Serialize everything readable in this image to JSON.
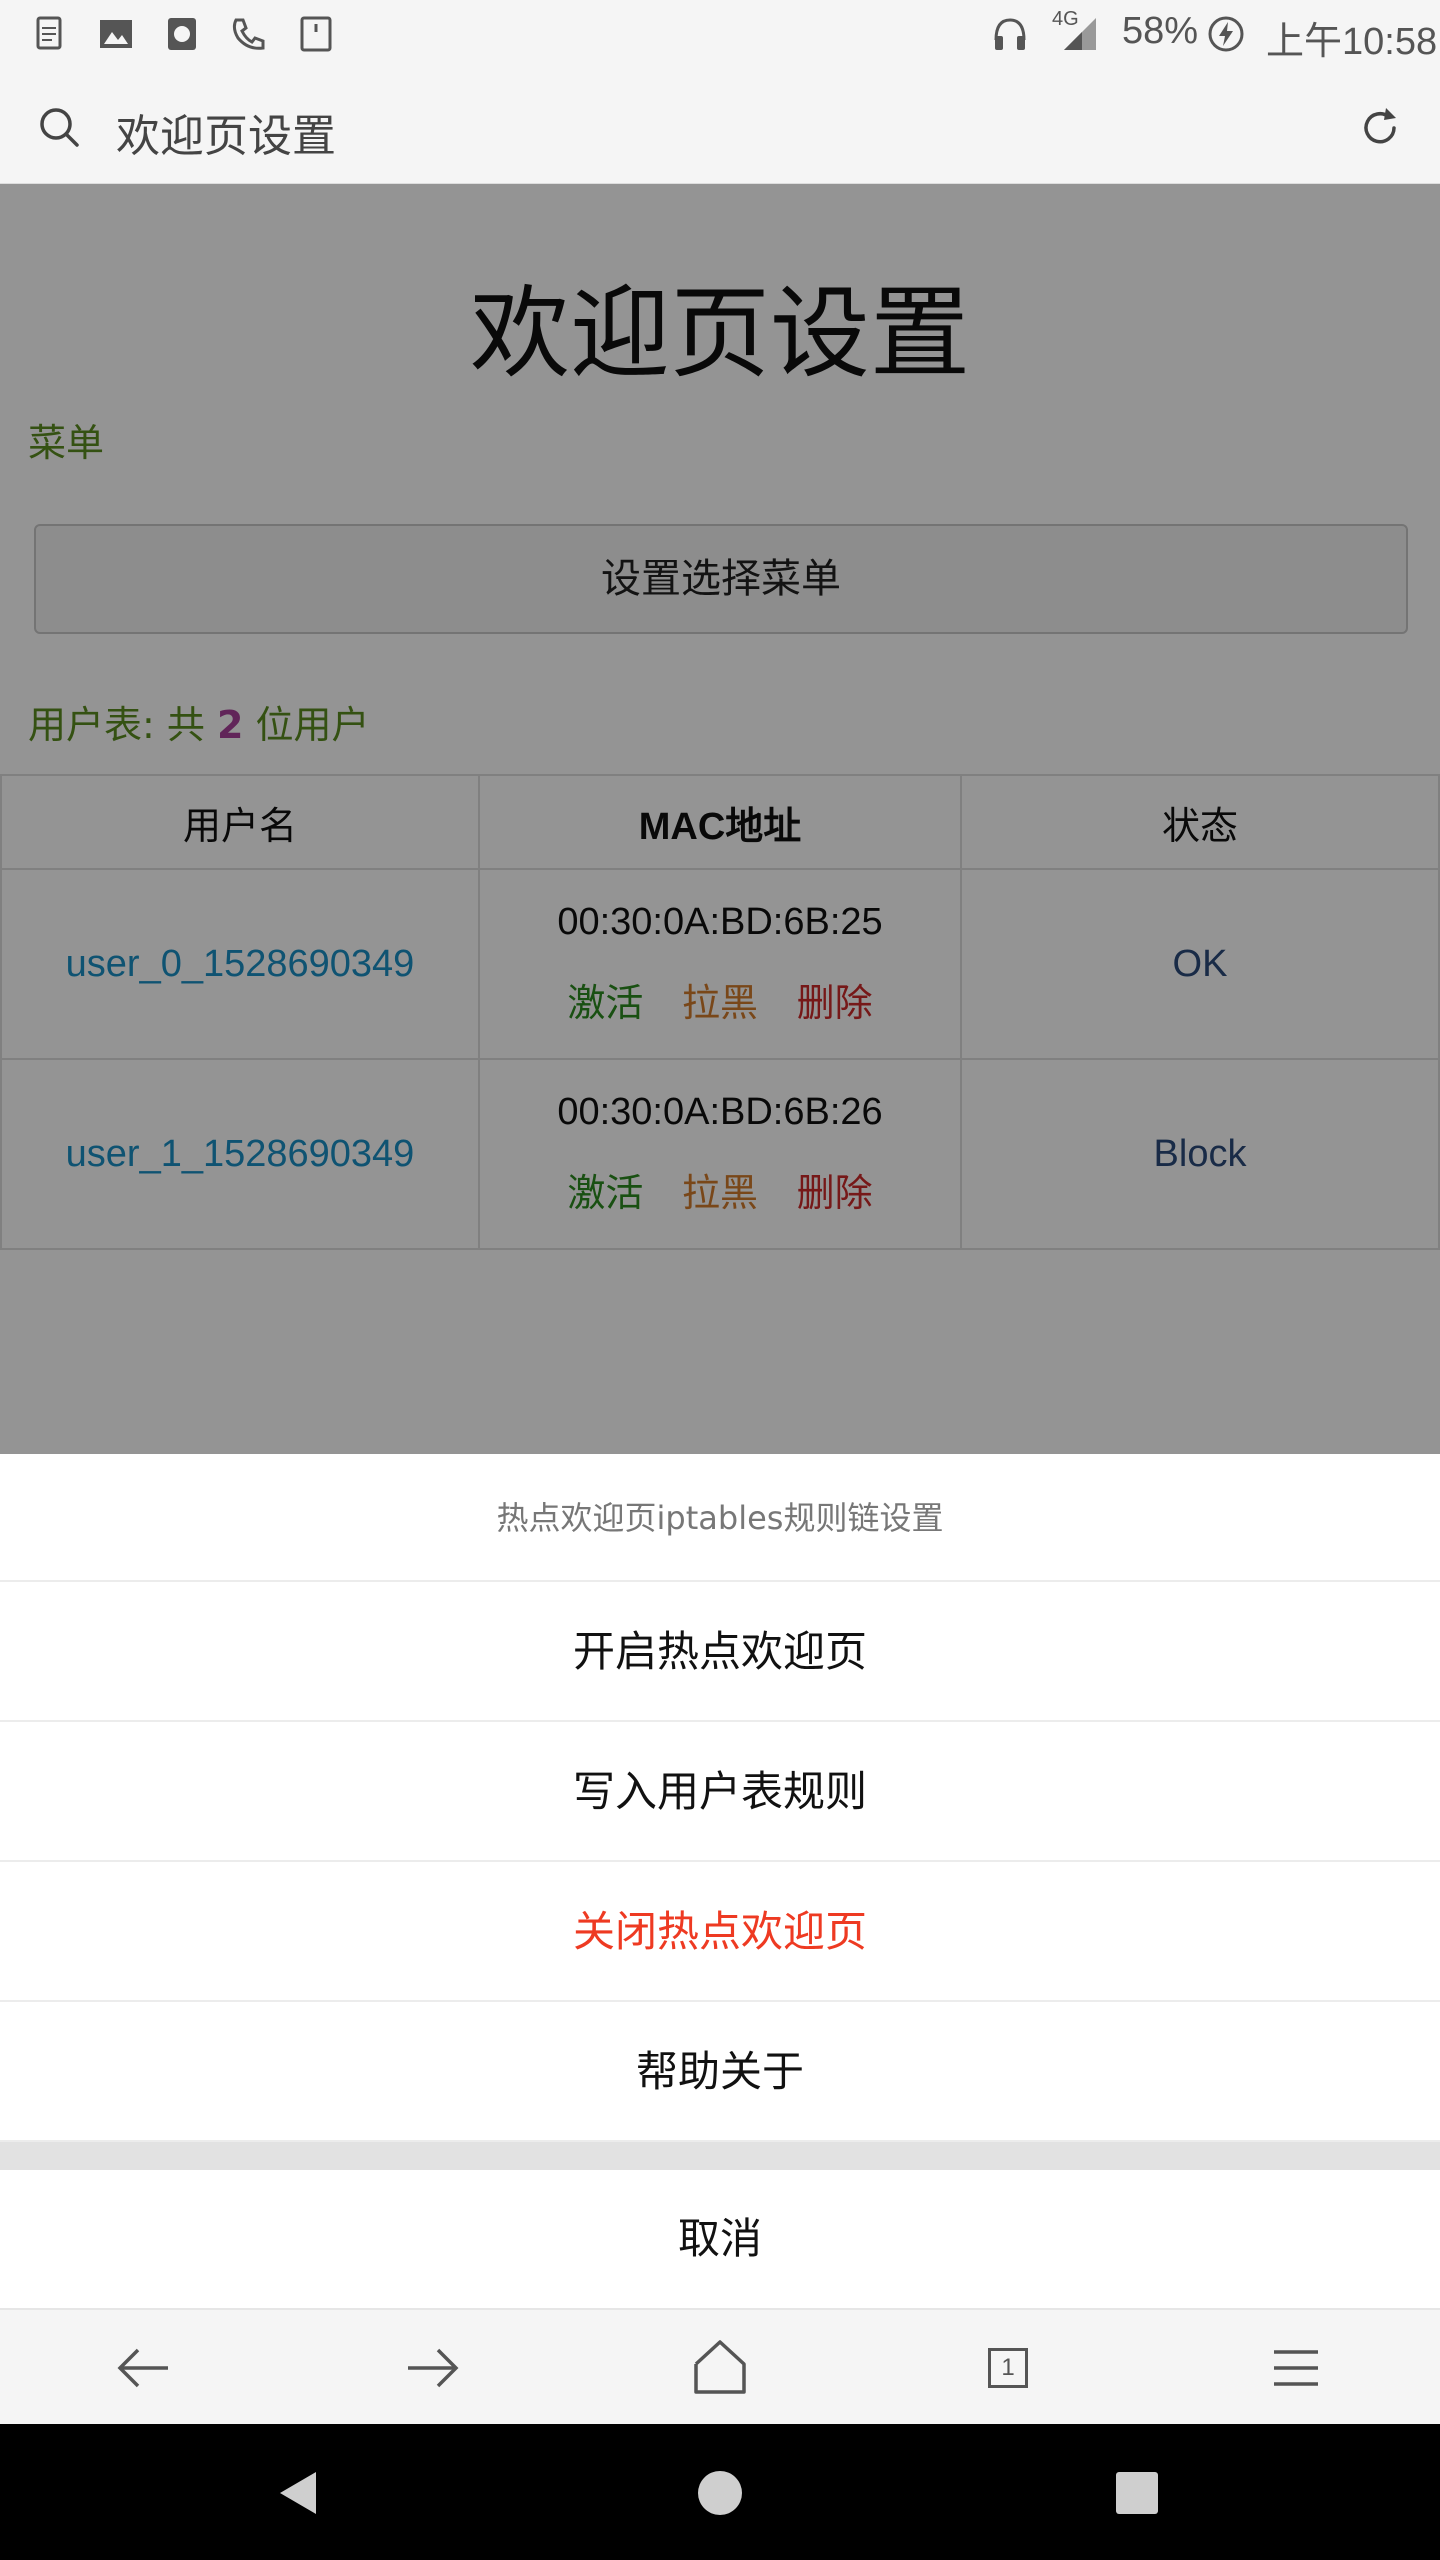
{
  "status_bar": {
    "battery": "58%",
    "network": "4G",
    "time": "上午10:58",
    "left_icons": [
      "document-icon",
      "image-icon",
      "app-icon",
      "phone-icon",
      "sd-card-icon"
    ]
  },
  "url_bar": {
    "title": "欢迎页设置"
  },
  "page": {
    "title": "欢迎页设置",
    "menu_label": "菜单",
    "menu_button": "设置选择菜单",
    "user_count_prefix": "用户表: 共",
    "user_count": "2",
    "user_count_suffix": "位用户",
    "table": {
      "headers": [
        "用户名",
        "MAC地址",
        "状态"
      ],
      "rows": [
        {
          "username": "user_0_1528690349",
          "mac": "00:30:0A:BD:6B:25",
          "actions": [
            "激活",
            "拉黑",
            "删除"
          ],
          "status": "OK"
        },
        {
          "username": "user_1_1528690349",
          "mac": "00:30:0A:BD:6B:26",
          "actions": [
            "激活",
            "拉黑",
            "删除"
          ],
          "status": "Block"
        }
      ]
    }
  },
  "action_sheet": {
    "title": "热点欢迎页iptables规则链设置",
    "items": [
      "开启热点欢迎页",
      "写入用户表规则",
      "关闭热点欢迎页",
      "帮助关于"
    ],
    "cancel": "取消"
  },
  "toolbar": {
    "tab_count": "1"
  },
  "colors": {
    "accent_green": "#5b8c1f",
    "username_blue": "#1a8fc4",
    "danger_red": "#ee3a22",
    "count_purple": "#a8409a"
  }
}
